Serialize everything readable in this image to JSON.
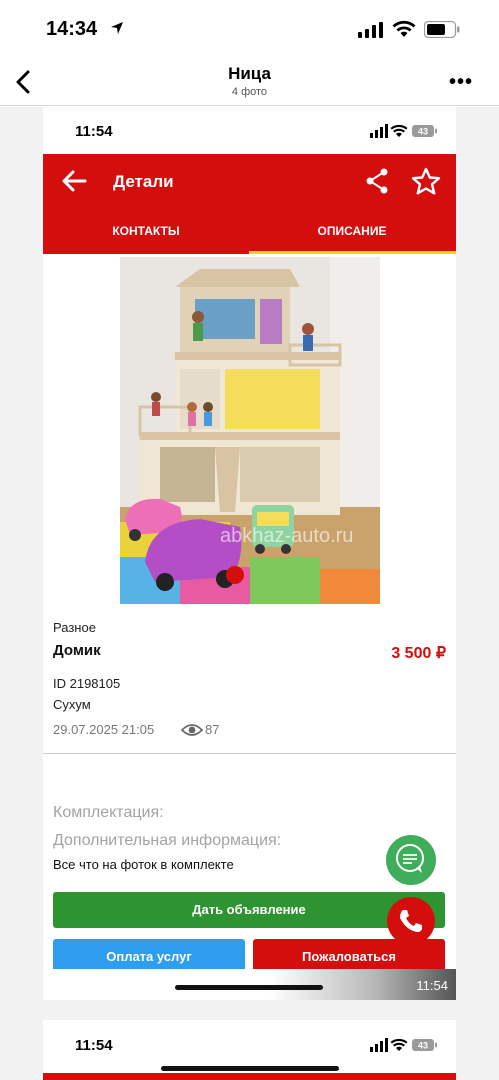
{
  "outer_status": {
    "time": "14:34"
  },
  "nav": {
    "title": "Ница",
    "subtitle": "4 фото"
  },
  "inner_status": {
    "time": "11:54",
    "battery": "43"
  },
  "app": {
    "title": "Детали",
    "tabs": [
      {
        "label": "КОНТАКТЫ",
        "active": false
      },
      {
        "label": "ОПИСАНИЕ",
        "active": true
      }
    ],
    "accent_color": "#d40d0d",
    "tab_indicator_color": "#ffd400"
  },
  "listing": {
    "category": "Разное",
    "title": "Домик",
    "price": "3 500 ₽",
    "id": "ID 2198105",
    "city": "Сухум",
    "date": "29.07.2025 21:05",
    "views": "87",
    "watermark": "abkhaz-auto.ru"
  },
  "details": {
    "komplektaciya": "Комплектация:",
    "dop_info": "Дополнительная информация:",
    "text": "Все что на фоток в комплекте"
  },
  "buttons": {
    "post_ad": "Дать объявление",
    "pay": "Оплата услуг",
    "report": "Пожаловаться"
  },
  "video": {
    "time": "11:54"
  },
  "next_shot": {
    "time": "11:54",
    "battery": "43"
  }
}
